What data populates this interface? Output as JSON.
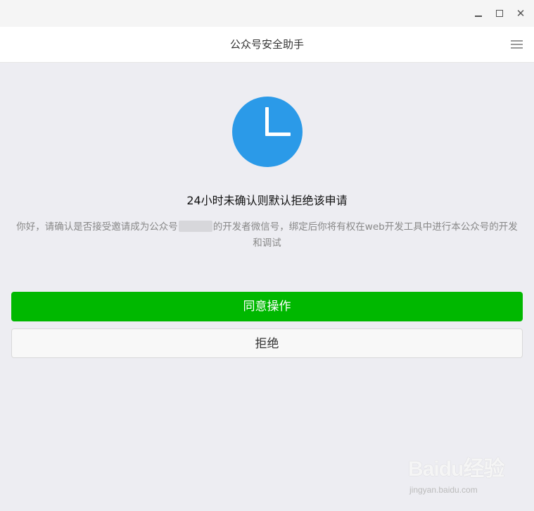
{
  "window": {
    "minimize_icon": "minimize-icon",
    "maximize_icon": "maximize-icon",
    "close_glyph": "✕"
  },
  "header": {
    "title": "公众号安全助手",
    "menu_icon": "hamburger-menu-icon"
  },
  "notice": {
    "icon": "clock-icon",
    "title": "24小时未确认则默认拒绝该申请",
    "desc_before": "你好，请确认是否接受邀请成为公众号",
    "desc_after": "的开发者微信号，绑定后你将有权在web开发工具中进行本公众号的开发\n和调试"
  },
  "actions": {
    "accept_label": "同意操作",
    "reject_label": "拒绝"
  },
  "watermark": {
    "brand": "Baidu经验",
    "site": "jingyan.baidu.com"
  },
  "colors": {
    "accent_green": "#00b800",
    "clock_blue": "#2b9ae8",
    "background": "#ededf2"
  }
}
